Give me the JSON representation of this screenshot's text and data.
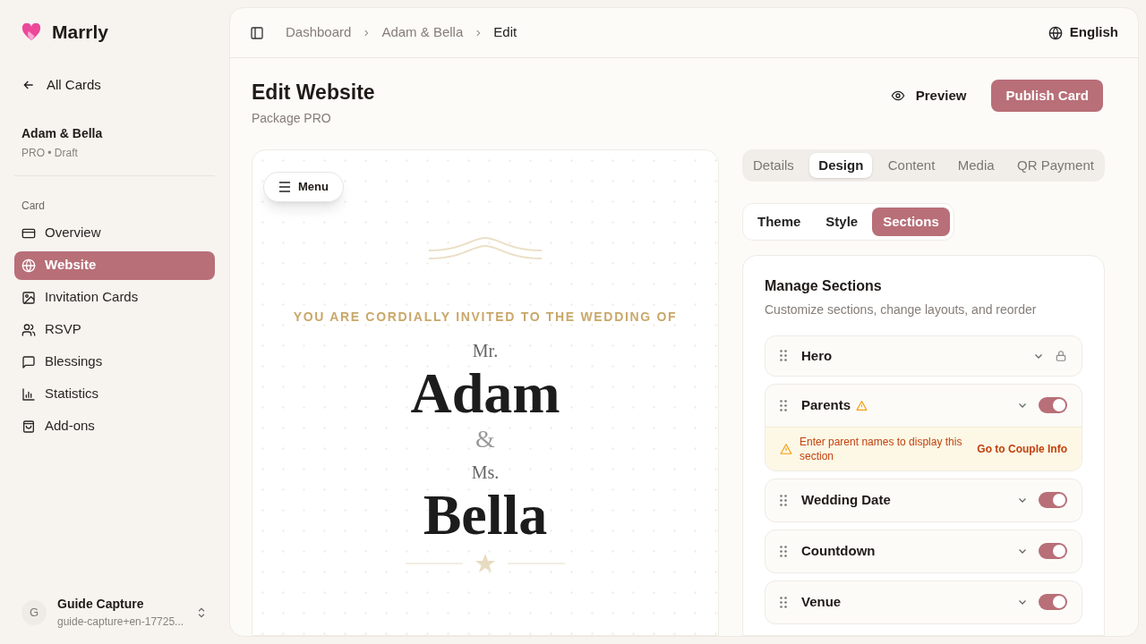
{
  "brand": {
    "name": "Marrly"
  },
  "back_link": "All Cards",
  "card_info": {
    "title": "Adam & Bella",
    "subtitle": "PRO • Draft"
  },
  "sidebar": {
    "section_label": "Card",
    "items": [
      {
        "label": "Overview",
        "kind": "card",
        "selected": false
      },
      {
        "label": "Website",
        "kind": "globe",
        "selected": true
      },
      {
        "label": "Invitation Cards",
        "kind": "image",
        "selected": false
      },
      {
        "label": "RSVP",
        "kind": "users",
        "selected": false
      },
      {
        "label": "Blessings",
        "kind": "message",
        "selected": false
      },
      {
        "label": "Statistics",
        "kind": "chart",
        "selected": false
      },
      {
        "label": "Add-ons",
        "kind": "bag",
        "selected": false
      }
    ]
  },
  "user": {
    "initial": "G",
    "name": "Guide Capture",
    "email": "guide-capture+en-17725..."
  },
  "breadcrumbs": [
    "Dashboard",
    "Adam & Bella",
    "Edit"
  ],
  "language": "English",
  "page": {
    "title": "Edit Website",
    "subtitle": "Package PRO",
    "preview_button": "Preview",
    "publish_button": "Publish Card"
  },
  "preview": {
    "menu_button": "Menu",
    "invite_line": "YOU ARE CORDIALLY INVITED TO THE WEDDING OF",
    "groom_title": "Mr.",
    "groom_name": "Adam",
    "ampersand": "&",
    "bride_title": "Ms.",
    "bride_name": "Bella"
  },
  "tabs": [
    {
      "label": "Details",
      "selected": false
    },
    {
      "label": "Design",
      "selected": true
    },
    {
      "label": "Content",
      "selected": false
    },
    {
      "label": "Media",
      "selected": false
    },
    {
      "label": "QR Payment",
      "selected": false
    }
  ],
  "subtabs": [
    {
      "label": "Theme",
      "selected": false
    },
    {
      "label": "Style",
      "selected": false
    },
    {
      "label": "Sections",
      "selected": true
    }
  ],
  "sections_panel": {
    "title": "Manage Sections",
    "subtitle": "Customize sections, change layouts, and reorder",
    "sections": [
      {
        "name": "Hero",
        "kind": "locked"
      },
      {
        "name": "Parents",
        "kind": "toggle",
        "on": true,
        "warning": {
          "message": "Enter parent names to display this section",
          "action": "Go to Couple Info"
        }
      },
      {
        "name": "Wedding Date",
        "kind": "toggle",
        "on": true
      },
      {
        "name": "Countdown",
        "kind": "toggle",
        "on": true
      },
      {
        "name": "Venue",
        "kind": "toggle",
        "on": true
      }
    ]
  }
}
